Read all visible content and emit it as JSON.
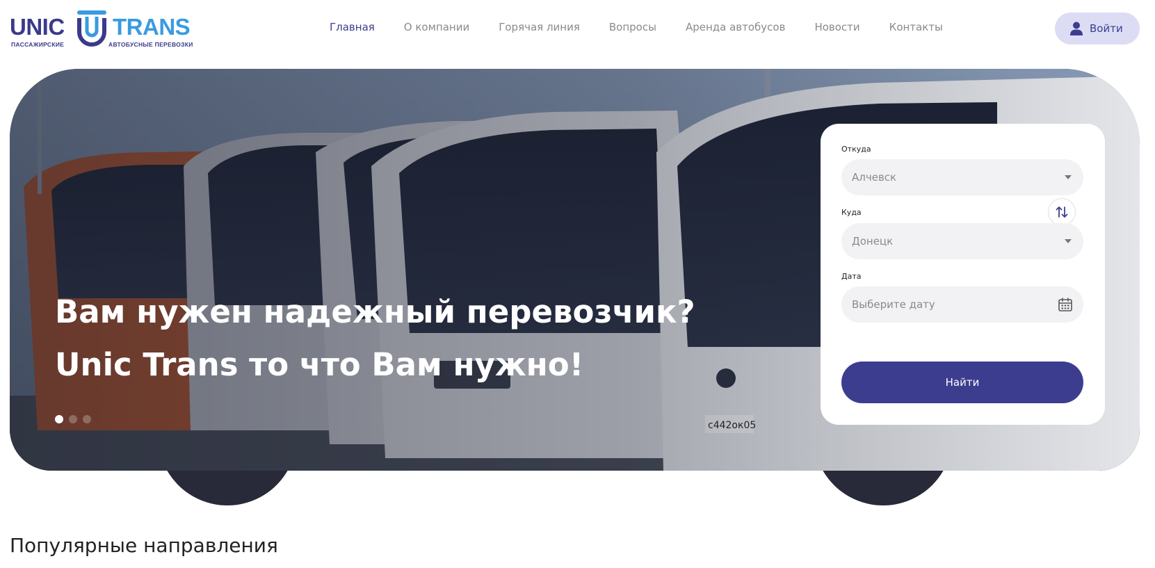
{
  "logo": {
    "word1": "UNIC",
    "word2": "TRANS",
    "sub1": "ПАССАЖИРСКИЕ",
    "sub2": "АВТОБУСНЫЕ ПЕРЕВОЗКИ",
    "colors": {
      "dark": "#3a3a8c",
      "light": "#3a9be0"
    }
  },
  "nav": {
    "items": [
      {
        "label": "Главная",
        "active": true
      },
      {
        "label": "О компании"
      },
      {
        "label": "Горячая линия"
      },
      {
        "label": "Вопросы"
      },
      {
        "label": "Аренда автобусов"
      },
      {
        "label": "Новости"
      },
      {
        "label": "Контакты"
      }
    ]
  },
  "login": {
    "label": "Войти",
    "icon": "user-icon"
  },
  "hero": {
    "line1": "Вам нужен надежный перевозчик?",
    "line2": "Unic Trans то что Вам нужно!",
    "slides_total": 3,
    "slide_active": 1
  },
  "search": {
    "from_label": "Откуда",
    "from_value": "Алчевск",
    "to_label": "Куда",
    "to_value": "Донецк",
    "date_label": "Дата",
    "date_placeholder": "Выберите дату",
    "swap_icon": "swap-arrows-icon",
    "calendar_icon": "calendar-icon",
    "submit_label": "Найти"
  },
  "sections": {
    "popular_title": "Популярные направления"
  },
  "colors": {
    "accent": "#3d3d8f",
    "accent_soft": "#dcdcf5"
  }
}
